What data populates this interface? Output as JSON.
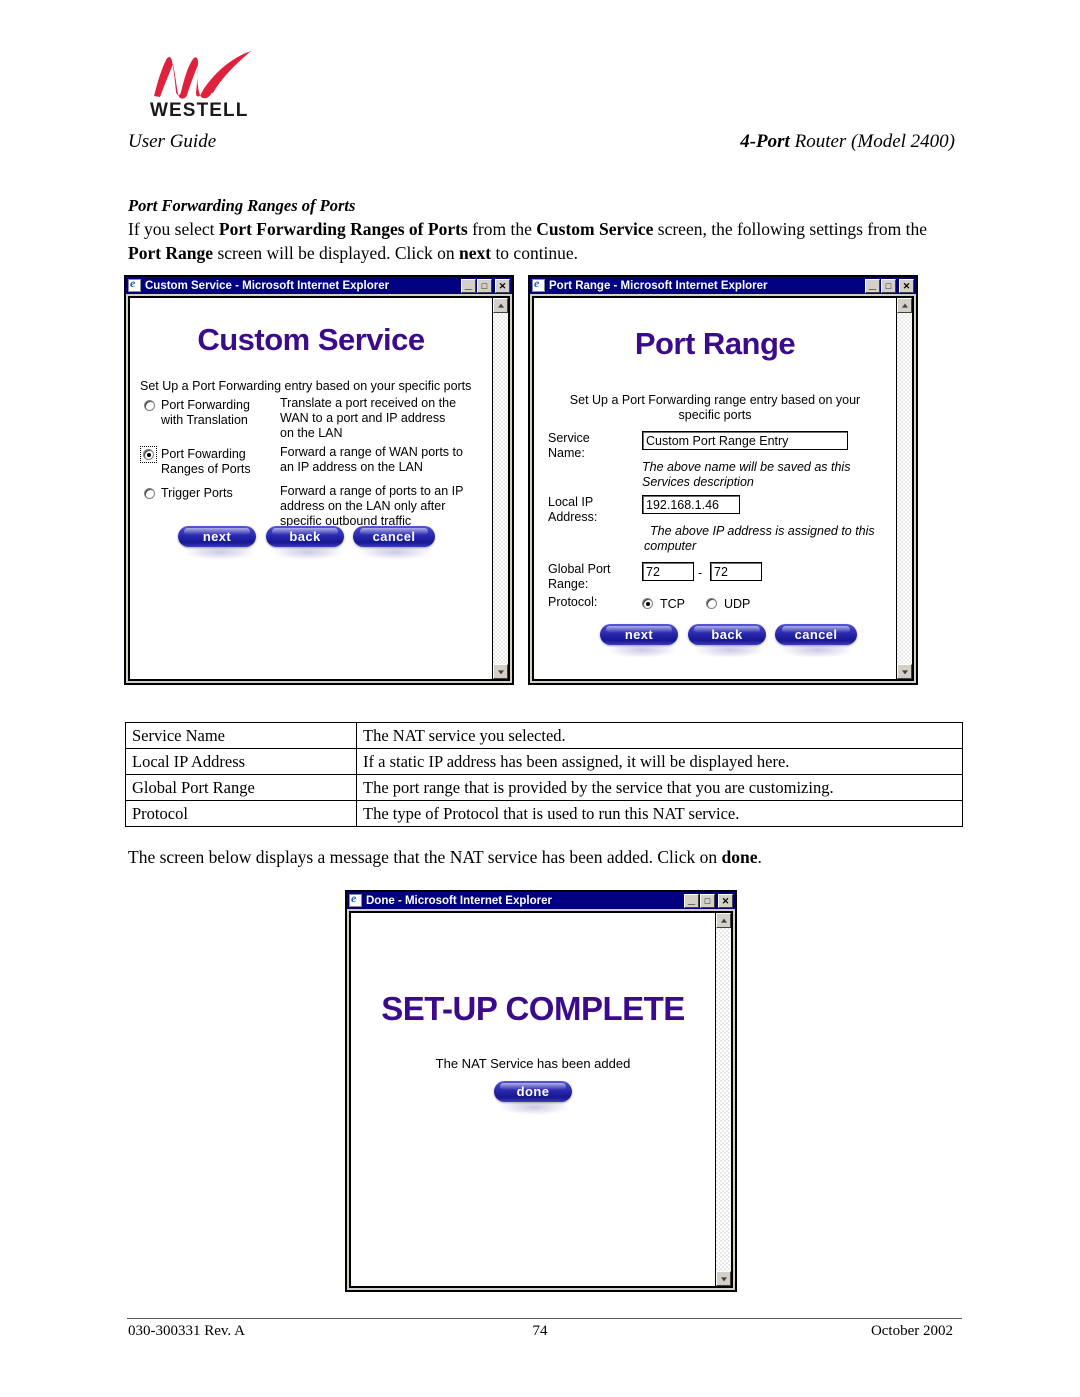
{
  "header": {
    "logo_mark": "westell-w-logo",
    "logo_wordmark": "WESTELL",
    "left": "User Guide",
    "right_prefix": "4-Port",
    "right_rest": " Router (Model 2400)"
  },
  "section": {
    "title": "Port Forwarding Ranges of Ports",
    "paragraph_1": {
      "t1": "If you select ",
      "b1": "Port Forwarding Ranges of Ports",
      "t2": " from the ",
      "b2": "Custom Service",
      "t3": " screen, the following settings from the ",
      "b3": "Port Range",
      "t4": " screen will be displayed. Click on ",
      "b4": "next",
      "t5": " to continue."
    },
    "paragraph_2": {
      "t1": "The screen below displays a message that the NAT service has been added. Click on ",
      "b1": "done",
      "t2": "."
    }
  },
  "custom_service_window": {
    "title": "Custom Service - Microsoft Internet Explorer",
    "titlebar_buttons": {
      "minimize": "_",
      "maximize": "□",
      "close": "✕"
    },
    "heading": "Custom Service",
    "intro": "Set Up a Port Forwarding entry based on your specific ports",
    "options": [
      {
        "label_line1": "Port Forwarding",
        "label_line2": "with Translation",
        "selected": false,
        "desc_line1": "Translate a port received on the",
        "desc_line2": "WAN to a port and IP address",
        "desc_line3": "on the LAN"
      },
      {
        "label_line1": "Port Fowarding",
        "label_line2": "Ranges of Ports",
        "selected": true,
        "desc_line1": "Forward a range of WAN ports to",
        "desc_line2": "an IP address on the LAN",
        "desc_line3": ""
      },
      {
        "label_line1": "Trigger Ports",
        "label_line2": "",
        "selected": false,
        "desc_line1": "Forward a range of ports to an IP",
        "desc_line2": "address on the LAN only after",
        "desc_line3": "specific outbound traffic"
      }
    ],
    "buttons": {
      "next": "next",
      "back": "back",
      "cancel": "cancel"
    }
  },
  "port_range_window": {
    "title": "Port Range - Microsoft Internet Explorer",
    "titlebar_buttons": {
      "minimize": "_",
      "maximize": "□",
      "close": "✕"
    },
    "heading": "Port Range",
    "intro_line1": "Set Up a Port Forwarding range entry based on your",
    "intro_line2": "specific ports",
    "fields": {
      "service_name_label_line1": "Service",
      "service_name_label_line2": "Name:",
      "service_name_value": "Custom Port Range Entry",
      "service_name_note_line1": "The above name will be saved as this",
      "service_name_note_line2": "Services description",
      "local_ip_label_line1": "Local IP",
      "local_ip_label_line2": "Address:",
      "local_ip_value": "192.168.1.46",
      "local_ip_note_line1": "The above IP address is assigned to this",
      "local_ip_note_line2": "computer",
      "global_port_label_line1": "Global Port",
      "global_port_label_line2": "Range:",
      "global_port_start": "72",
      "global_port_separator": "-",
      "global_port_end": "72",
      "protocol_label": "Protocol:",
      "protocol_tcp": "TCP",
      "protocol_udp": "UDP",
      "protocol_selected": "TCP"
    },
    "buttons": {
      "next": "next",
      "back": "back",
      "cancel": "cancel"
    }
  },
  "done_window": {
    "title": "Done - Microsoft Internet Explorer",
    "titlebar_buttons": {
      "minimize": "_",
      "maximize": "□",
      "close": "✕"
    },
    "heading": "SET-UP COMPLETE",
    "message": "The NAT Service has been added",
    "buttons": {
      "done": "done"
    }
  },
  "description_table": {
    "rows": [
      {
        "term": "Service Name",
        "definition": "The NAT service you selected."
      },
      {
        "term": "Local IP Address",
        "definition": "If a static IP address has been assigned, it will be displayed here."
      },
      {
        "term": "Global Port Range",
        "definition": "The port range that is provided by the service that you are customizing."
      },
      {
        "term": "Protocol",
        "definition": "The type of Protocol that is used to run this NAT service."
      }
    ]
  },
  "footer": {
    "left": "030-300331 Rev. A",
    "center": "74",
    "right": "October 2002"
  },
  "colors": {
    "heading_purple": "#3b0b8c",
    "titlebar_navy": "#000080",
    "logo_red": "#e0213c",
    "button_blue": "#2323a8",
    "chrome_gray": "#d4d0c8"
  }
}
